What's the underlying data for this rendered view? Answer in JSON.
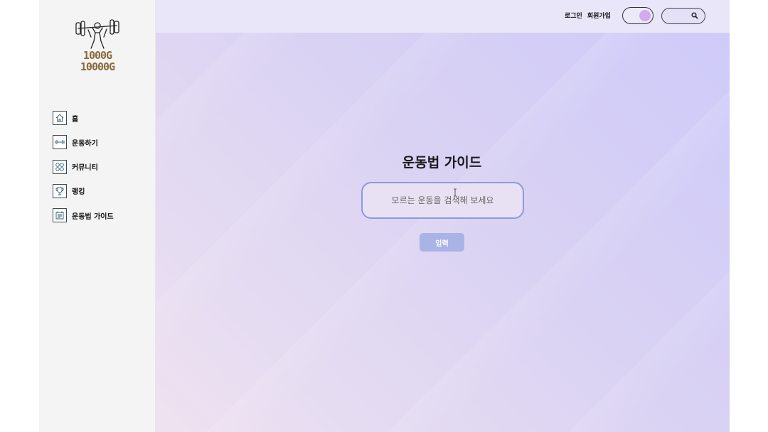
{
  "sidebar": {
    "logo_text_line1": "1000G",
    "logo_text_line2": "10000G",
    "items": [
      {
        "label": "홈",
        "icon": "home-icon"
      },
      {
        "label": "운동하기",
        "icon": "dumbbell-icon"
      },
      {
        "label": "커뮤니티",
        "icon": "community-icon"
      },
      {
        "label": "랭킹",
        "icon": "trophy-icon"
      },
      {
        "label": "운동법 가이드",
        "icon": "guide-icon"
      }
    ]
  },
  "header": {
    "login_label": "로그인",
    "signup_label": "회원가입",
    "search_icon": "search-icon",
    "toggle_icon": "theme-toggle"
  },
  "main": {
    "title": "운동법 가이드",
    "search_placeholder": "모르는 운동을 검색해 보세요",
    "submit_label": "입력"
  },
  "colors": {
    "sidebar_bg": "#f4f4f5",
    "header_bg": "#e9e6f9",
    "accent_button": "#a9b3e6",
    "input_border": "#8f98d9",
    "toggle_knob": "#d4a9ee",
    "logo_gold": "#8a6a3a"
  }
}
